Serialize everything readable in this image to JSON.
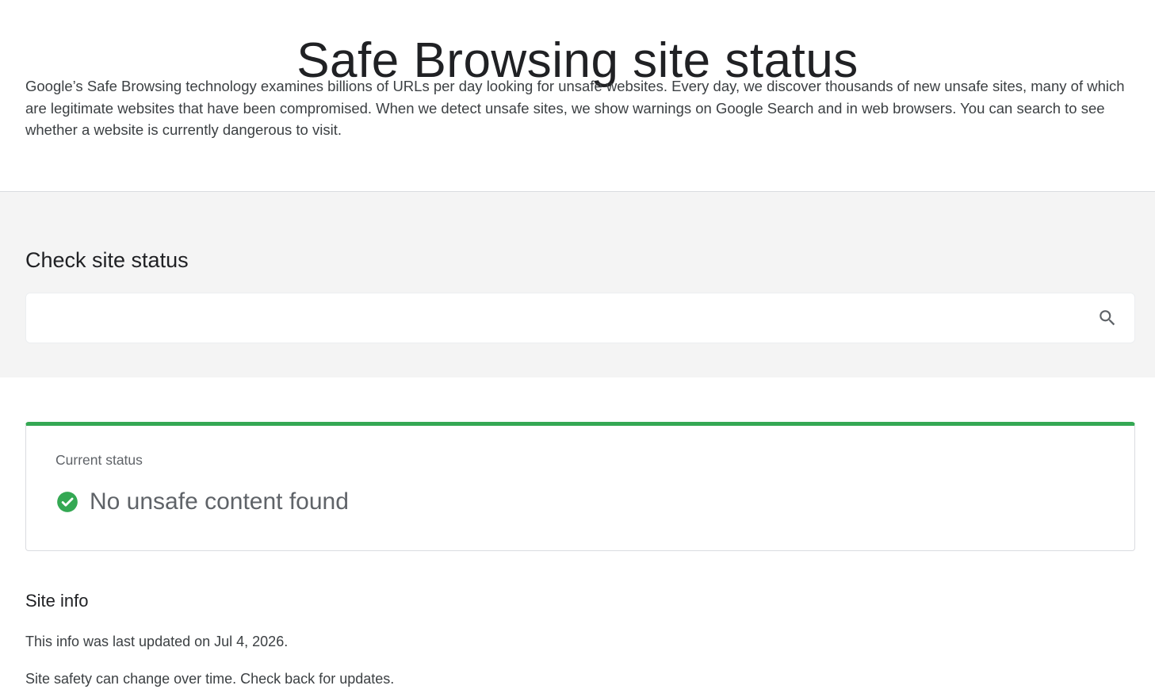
{
  "page": {
    "title": "Safe Browsing site status",
    "intro": "Google’s Safe Browsing technology examines billions of URLs per day looking for unsafe websites. Every day, we discover thousands of new unsafe sites, many of which are legitimate websites that have been compromised. When we detect unsafe sites, we show warnings on Google Search and in web browsers. You can search to see whether a website is currently dangerous to visit."
  },
  "search": {
    "heading": "Check site status",
    "value": "",
    "icon": "search-icon"
  },
  "status": {
    "label": "Current status",
    "text": "No unsafe content found",
    "icon": "check-circle-icon",
    "accent_color": "#34a853"
  },
  "site_info": {
    "title": "Site info",
    "updated": "This info was last updated on Jul 4, 2026.",
    "safety_note": "Site safety can change over time. Check back for updates."
  }
}
